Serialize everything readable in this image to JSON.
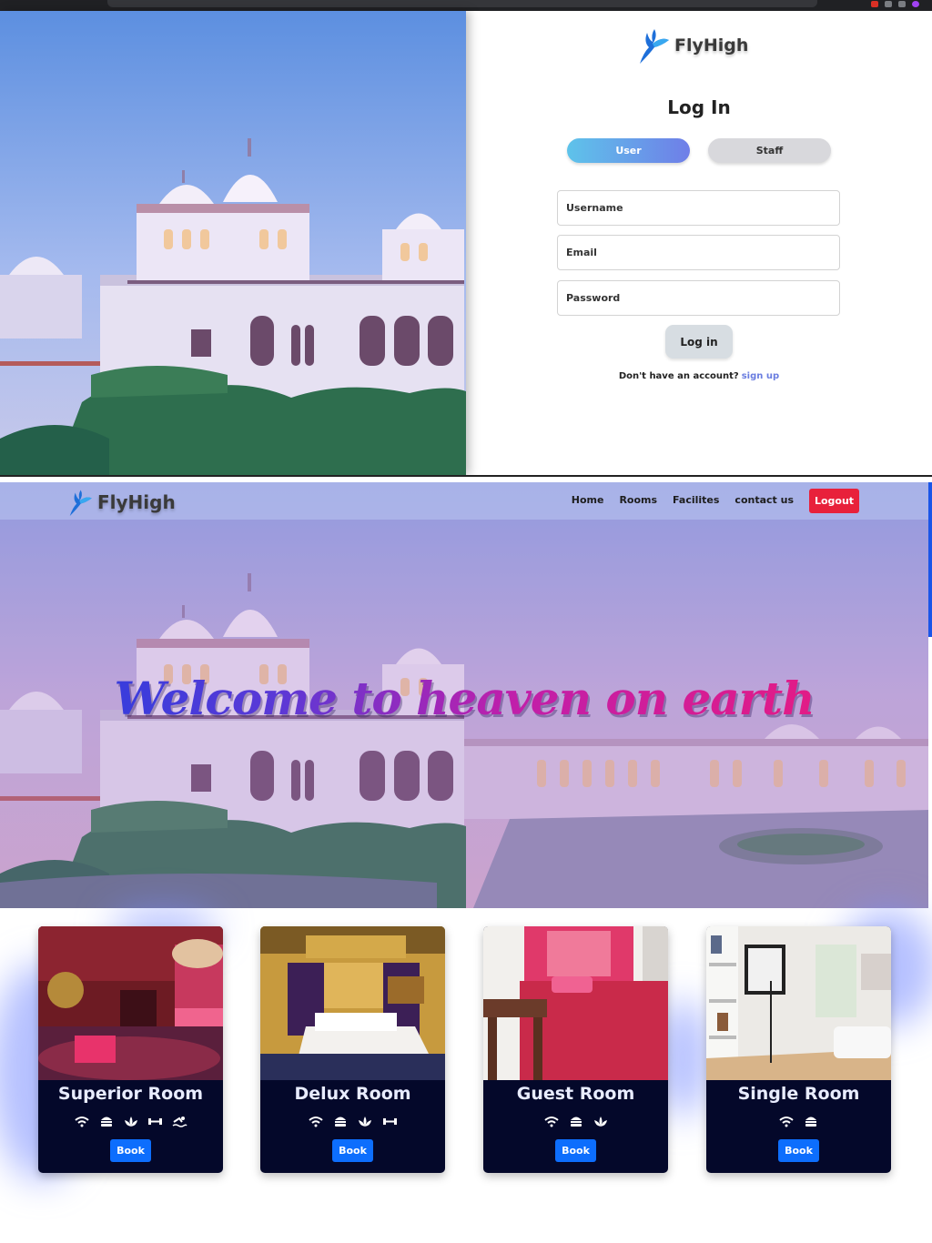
{
  "login": {
    "brand": "FlyHigh",
    "title": "Log In",
    "roles": {
      "user": "User",
      "staff": "Staff",
      "selected": "User"
    },
    "username_placeholder": "Username",
    "email_placeholder": "Email",
    "password_placeholder": "Password",
    "submit_label": "Log in",
    "signup_prompt": "Don't have an account?",
    "signup_link": "sign up"
  },
  "navbar": {
    "brand": "FlyHigh",
    "links": [
      "Home",
      "Rooms",
      "Facilites",
      "contact us"
    ],
    "logout_label": "Logout"
  },
  "hero": {
    "title": "Welcome to heaven on earth"
  },
  "rooms": [
    {
      "name": "Superior Room",
      "amenities": [
        "wifi-icon",
        "burger-icon",
        "lotus-icon",
        "dumbbell-icon",
        "swimmer-icon"
      ],
      "book_label": "Book"
    },
    {
      "name": "Delux Room",
      "amenities": [
        "wifi-icon",
        "burger-icon",
        "lotus-icon",
        "dumbbell-icon"
      ],
      "book_label": "Book"
    },
    {
      "name": "Guest Room",
      "amenities": [
        "wifi-icon",
        "burger-icon",
        "lotus-icon"
      ],
      "book_label": "Book"
    },
    {
      "name": "Single Room",
      "amenities": [
        "wifi-icon",
        "burger-icon"
      ],
      "book_label": "Book"
    }
  ],
  "colors": {
    "accent_blue": "#0d6efd",
    "logout_red": "#e8213b",
    "card_bg": "#04082a",
    "signup_link": "#6a7de0"
  }
}
